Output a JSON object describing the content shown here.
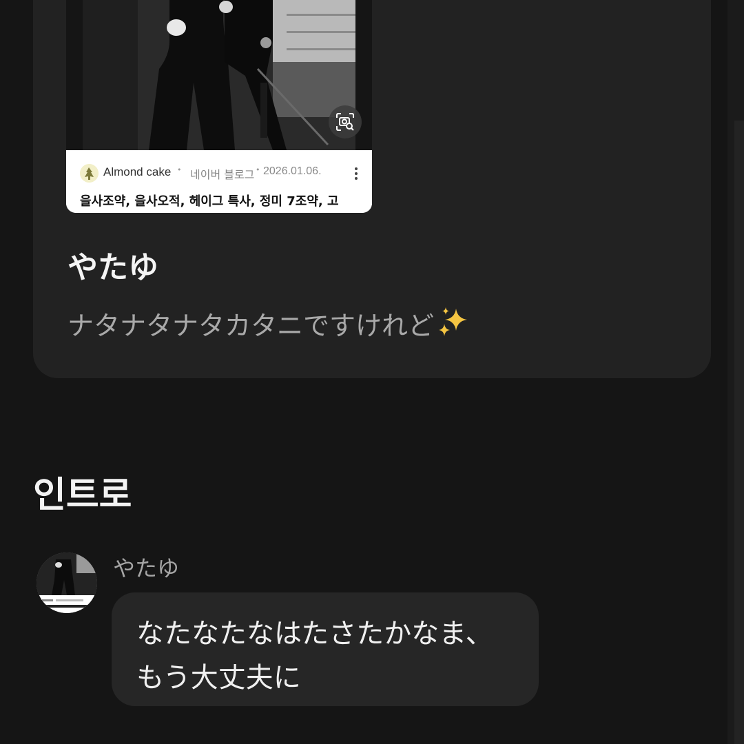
{
  "link_card": {
    "photo_icon": "image-search-icon",
    "source_name": "Almond cake",
    "separator": "•",
    "platform": "네이버 블로그",
    "date": "2026.01.06.",
    "more_icon": "more-vertical-icon",
    "title": "을사조약, 을사오적, 헤이그 특사, 정미 7조약, 고"
  },
  "post": {
    "author": "やたゆ",
    "text": "ナタナタナタカタニですけれど",
    "emoji_icon": "sparkles-icon"
  },
  "section": {
    "title": "인트로"
  },
  "chat": {
    "avatar_icon": "avatar-photo-icon",
    "name": "やたゆ",
    "lines": [
      "なたなたなはたさたかなま、",
      "もう大丈夫に"
    ]
  },
  "colors": {
    "background": "#151515",
    "card": "#222222",
    "bubble": "#262626",
    "muted_text": "#a9a9a9"
  }
}
